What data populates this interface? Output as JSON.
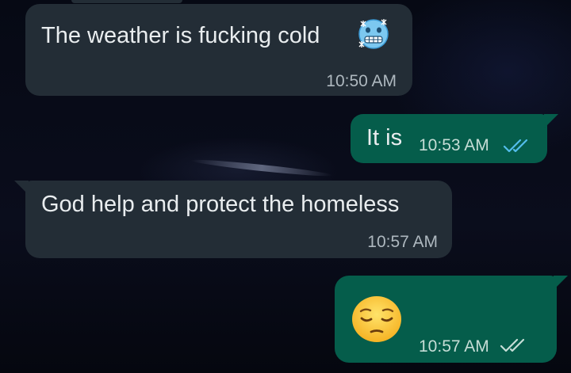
{
  "conversation": {
    "messages": [
      {
        "direction": "incoming",
        "text": "The weather is fucking cold",
        "emoji": "cold-face-emoji",
        "time": "10:50 AM"
      },
      {
        "direction": "outgoing",
        "text": "It is",
        "time": "10:53 AM",
        "status": "read",
        "status_icon": "double-check-read-icon"
      },
      {
        "direction": "incoming",
        "text": "God help and protect the homeless",
        "time": "10:57 AM"
      },
      {
        "direction": "outgoing",
        "emoji": "pensive-face-emoji",
        "time": "10:57 AM",
        "status": "delivered",
        "status_icon": "double-check-delivered-icon"
      }
    ]
  },
  "colors": {
    "incoming_bubble": "#232d36",
    "outgoing_bubble": "#055d4b",
    "read_tick": "#53bdeb",
    "delivered_tick": "#c5ddd6",
    "background": "#070a14"
  }
}
